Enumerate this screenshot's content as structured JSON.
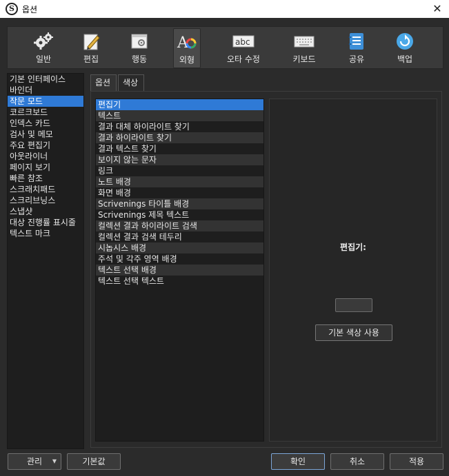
{
  "window": {
    "title": "옵션",
    "app_icon_letter": "S"
  },
  "toolbar": {
    "items": [
      {
        "label": "일반",
        "icon": "gears-icon"
      },
      {
        "label": "편집",
        "icon": "edit-pencil-icon"
      },
      {
        "label": "행동",
        "icon": "behavior-window-icon"
      },
      {
        "label": "외형",
        "icon": "appearance-ao-icon"
      },
      {
        "label": "오타 수정",
        "icon": "abc-spelling-icon"
      },
      {
        "label": "키보드",
        "icon": "keyboard-icon"
      },
      {
        "label": "공유",
        "icon": "share-icon"
      },
      {
        "label": "백업",
        "icon": "backup-icon"
      }
    ],
    "active_index": 3
  },
  "sidebar": {
    "items": [
      "기본 인터페이스",
      "바인더",
      "작문 모드",
      "코르크보드",
      "인덱스 카드",
      "검사 및 메모",
      "주요 편집기",
      "아웃라이너",
      "페이지 보기",
      "빠른 참조",
      "스크래치패드",
      "스크리브닝스",
      "스냅샷",
      "대상 진행률 표시줄",
      "텍스트 마크"
    ],
    "selected_index": 2
  },
  "tabs": {
    "options": "옵션",
    "colors": "색상"
  },
  "color_list": {
    "items": [
      "편집기",
      "텍스트",
      "결과 대체 하이라이트 찾기",
      "결과 하이라이트 찾기",
      "결과 텍스트 찾기",
      "보이지 않는 문자",
      "링크",
      "노트 배경",
      "화면 배경",
      "Scrivenings 타이틀 배경",
      "Scrivenings 제목 텍스트",
      "컬렉션 결과 하이라이트 검색",
      "컬렉션 결과 검색 테두리",
      "시놉시스 배경",
      "주석 및 각주 영역 배경",
      "텍스트 선택 배경",
      "텍스트 선택 텍스트"
    ],
    "selected_index": 0
  },
  "preview": {
    "label": "편집기:",
    "swatch_color": "#3a3a3a",
    "default_button": "기본 색상 사용"
  },
  "footer": {
    "manage": "관리",
    "defaults": "기본값",
    "ok": "확인",
    "cancel": "취소",
    "apply": "적용"
  },
  "colors": {
    "accent": "#2f7ad6",
    "background": "#2b2b2b"
  }
}
